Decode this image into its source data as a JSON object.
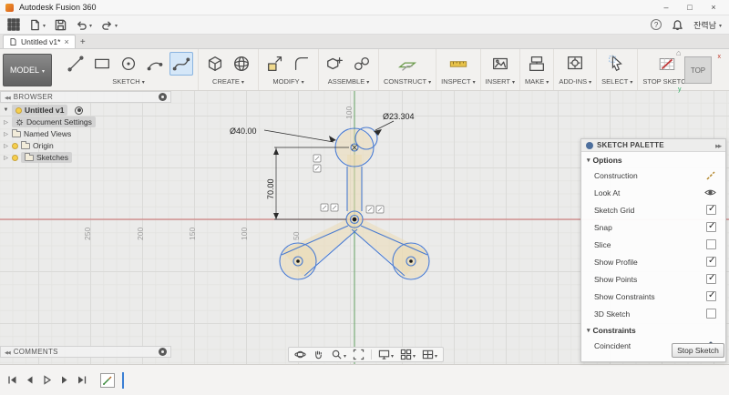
{
  "titlebar": {
    "title": "Autodesk Fusion 360"
  },
  "appbar": {
    "help": "?",
    "username": "잔력남"
  },
  "tabs": {
    "active": "Untitled v1*"
  },
  "ribbon": {
    "workspace": "MODEL",
    "groups": [
      {
        "label": "SKETCH"
      },
      {
        "label": "CREATE"
      },
      {
        "label": "MODIFY"
      },
      {
        "label": "ASSEMBLE"
      },
      {
        "label": "CONSTRUCT"
      },
      {
        "label": "INSPECT"
      },
      {
        "label": "INSERT"
      },
      {
        "label": "MAKE"
      },
      {
        "label": "ADD-INS"
      },
      {
        "label": "SELECT"
      }
    ],
    "stop_sketch": "STOP SKETCH"
  },
  "browser": {
    "header": "BROWSER",
    "root": "Untitled v1",
    "items": [
      {
        "label": "Document Settings"
      },
      {
        "label": "Named Views"
      },
      {
        "label": "Origin"
      },
      {
        "label": "Sketches"
      }
    ]
  },
  "comments": {
    "header": "COMMENTS"
  },
  "canvas": {
    "ruler_x": [
      "250",
      "200",
      "150",
      "100",
      "50"
    ],
    "ruler_y": "100",
    "dimensions": {
      "diameter_large": "Ø40.00",
      "diameter_small": "Ø23.304",
      "vertical": "70.00"
    }
  },
  "viewcube": {
    "face": "TOP",
    "axis_x": "x",
    "axis_y": "y"
  },
  "sketch_palette": {
    "title": "SKETCH PALETTE",
    "options_header": "Options",
    "options": [
      {
        "label": "Construction",
        "control": "icon"
      },
      {
        "label": "Look At",
        "control": "icon"
      },
      {
        "label": "Sketch Grid",
        "checked": true
      },
      {
        "label": "Snap",
        "checked": true
      },
      {
        "label": "Slice",
        "checked": false
      },
      {
        "label": "Show Profile",
        "checked": true
      },
      {
        "label": "Show Points",
        "checked": true
      },
      {
        "label": "Show Constraints",
        "checked": true
      },
      {
        "label": "3D Sketch",
        "checked": false
      }
    ],
    "constraints_header": "Constraints",
    "constraints": [
      {
        "label": "Coincident"
      }
    ],
    "stop_button": "Stop Sketch"
  },
  "colors": {
    "axis_x": "#c96a6a",
    "axis_y": "#63a063",
    "sketch_line": "#4a7bd0",
    "profile_fill": "#ecd9b0"
  }
}
